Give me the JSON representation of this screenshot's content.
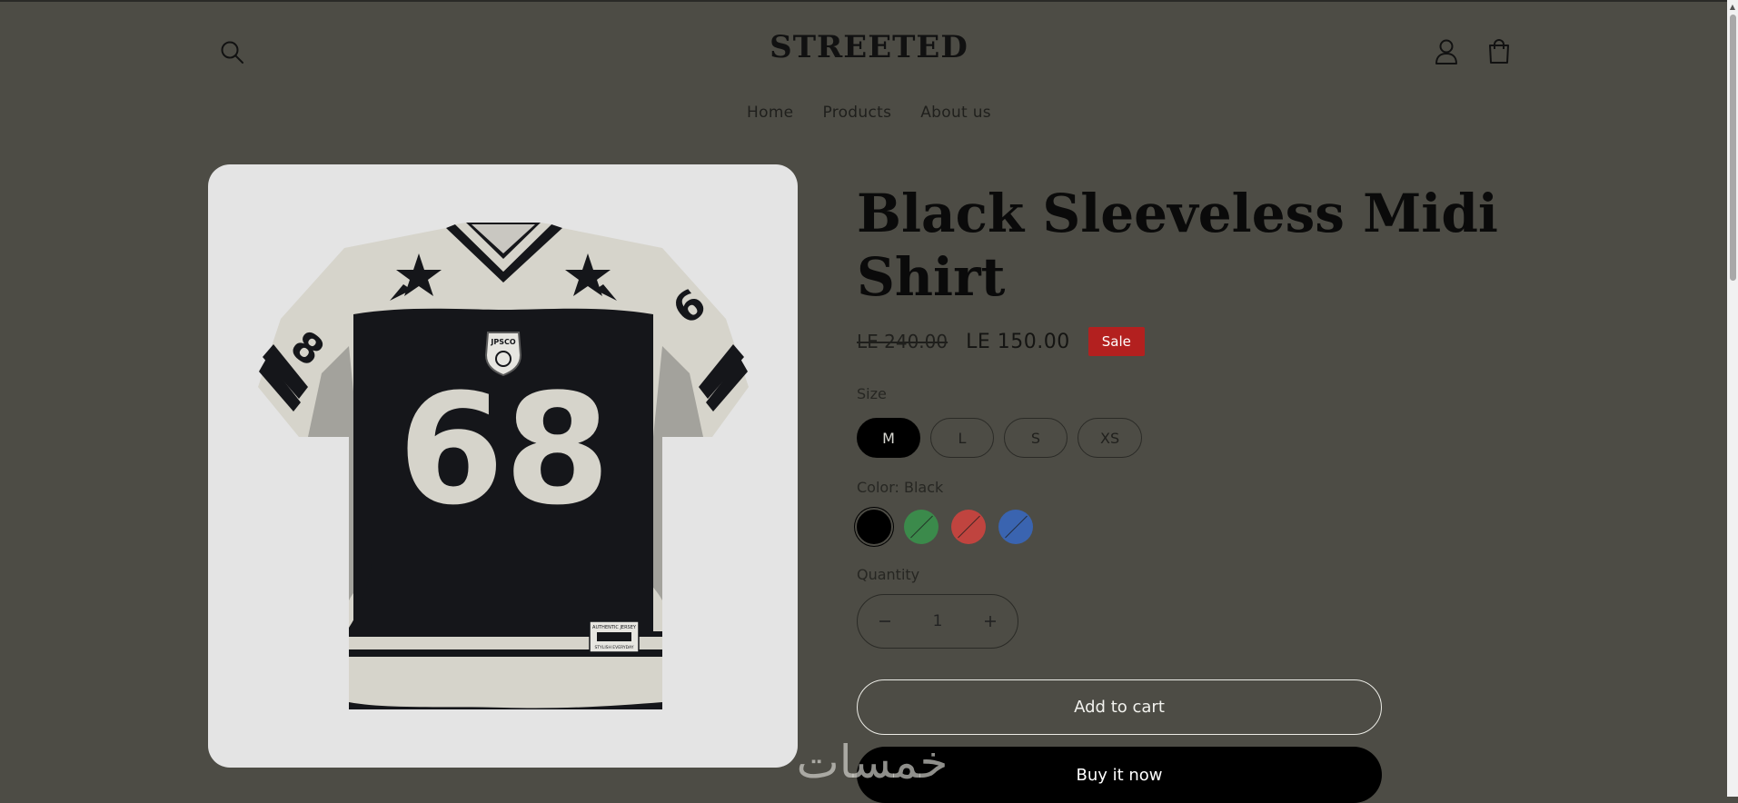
{
  "header": {
    "logo": "STREETED",
    "icons": [
      "search-icon",
      "account-icon",
      "cart-icon"
    ]
  },
  "nav": {
    "items": [
      {
        "label": "Home"
      },
      {
        "label": "Products"
      },
      {
        "label": "About us"
      }
    ]
  },
  "product": {
    "title": "Black Sleeveless Midi Shirt",
    "price_old": "LE 240.00",
    "price_new": "LE 150.00",
    "badge": "Sale",
    "image": {
      "number": "68",
      "crest": "JPSCO",
      "tag_line1": "AUTHENTIC JERSEY",
      "tag_line2": "STYLISH EVERYDAY"
    },
    "size": {
      "label": "Size",
      "options": [
        "M",
        "L",
        "S",
        "XS"
      ],
      "selected": "M"
    },
    "color": {
      "label": "Color: Black",
      "swatches": [
        {
          "name": "black",
          "hex": "#000000",
          "available": true,
          "selected": true
        },
        {
          "name": "green",
          "hex": "#3b8a4b",
          "available": false,
          "selected": false
        },
        {
          "name": "red",
          "hex": "#c0443f",
          "available": false,
          "selected": false
        },
        {
          "name": "blue",
          "hex": "#3a64b0",
          "available": false,
          "selected": false
        }
      ]
    },
    "quantity": {
      "label": "Quantity",
      "value": "1",
      "decrease_icon": "minus-icon",
      "increase_icon": "plus-icon"
    },
    "add_to_cart": "Add to cart",
    "buy_now": "Buy it now"
  },
  "watermark": "خمسات",
  "colors": {
    "background": "#4d4c45",
    "sale": "#b3201f",
    "image_bg": "#e4e4e4"
  }
}
